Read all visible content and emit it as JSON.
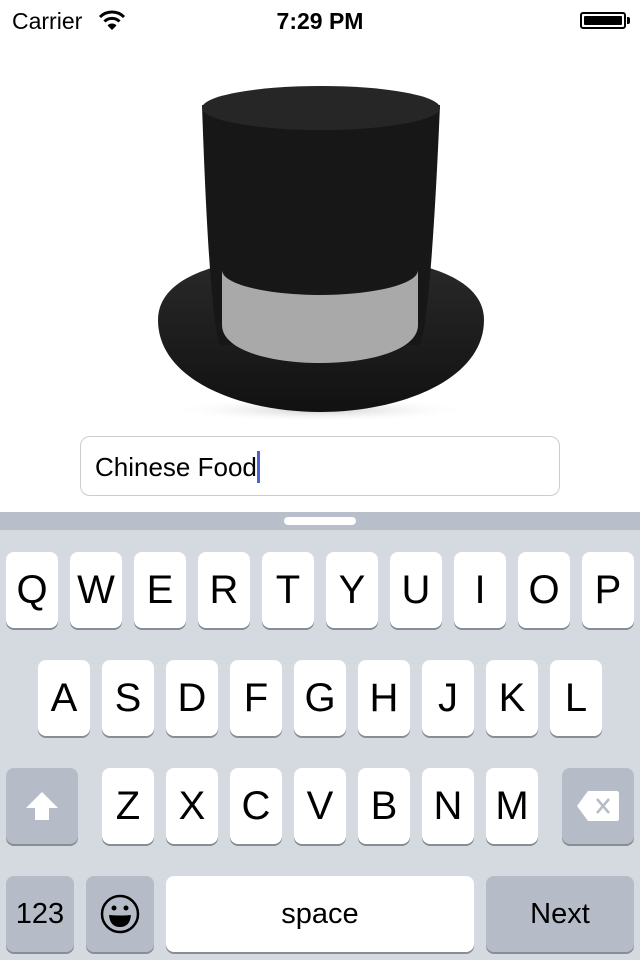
{
  "status_bar": {
    "carrier": "Carrier",
    "time": "7:29 PM",
    "wifi_icon": "wifi-icon",
    "battery_icon": "battery-icon"
  },
  "hero_image": {
    "description": "black top hat with grey band",
    "icon": "top-hat"
  },
  "text_field": {
    "value": "Chinese Food"
  },
  "keyboard": {
    "row1": [
      "Q",
      "W",
      "E",
      "R",
      "T",
      "Y",
      "U",
      "I",
      "O",
      "P"
    ],
    "row2": [
      "A",
      "S",
      "D",
      "F",
      "G",
      "H",
      "J",
      "K",
      "L"
    ],
    "row3": [
      "Z",
      "X",
      "C",
      "V",
      "B",
      "N",
      "M"
    ],
    "numbers_label": "123",
    "space_label": "space",
    "return_label": "Next",
    "shift_icon": "shift-icon",
    "delete_icon": "delete-icon",
    "emoji_icon": "emoji-icon"
  }
}
